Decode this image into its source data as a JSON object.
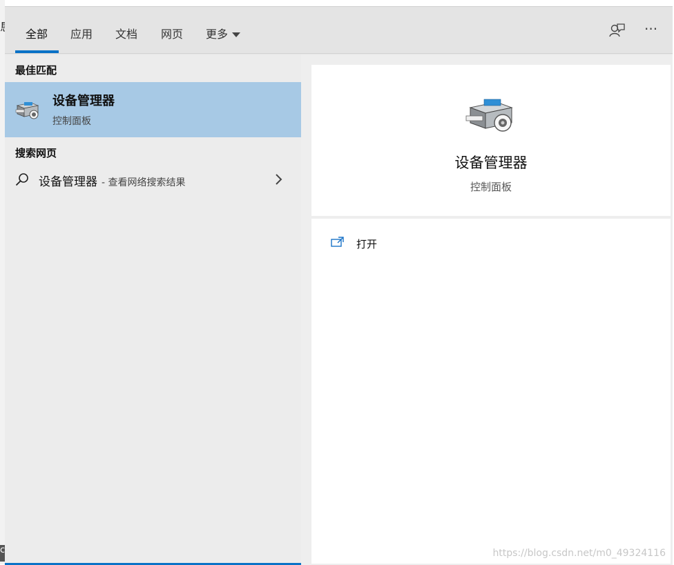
{
  "edge": {
    "fragment_top": "恳",
    "fragment_bottom": "c"
  },
  "tabs": [
    {
      "label": "全部",
      "active": true
    },
    {
      "label": "应用"
    },
    {
      "label": "文档"
    },
    {
      "label": "网页"
    },
    {
      "label": "更多"
    }
  ],
  "toolbar_icons": {
    "feedback": "feedback-icon",
    "more": "more-options-icon",
    "more_glyph": "···"
  },
  "left": {
    "best_match_heading": "最佳匹配",
    "best_match": {
      "title": "设备管理器",
      "subtitle": "控制面板",
      "icon": "device-manager-icon"
    },
    "web_heading": "搜索网页",
    "web_result": {
      "query": "设备管理器",
      "hint": "- 查看网络搜索结果",
      "icon": "search-icon"
    }
  },
  "right": {
    "title": "设备管理器",
    "subtitle": "控制面板",
    "actions": [
      {
        "label": "打开",
        "icon": "open-icon"
      }
    ]
  },
  "watermark": "https://blog.csdn.net/m0_49324116",
  "colors": {
    "accent": "#0a72c7",
    "selected_bg": "#a7c9e5"
  }
}
